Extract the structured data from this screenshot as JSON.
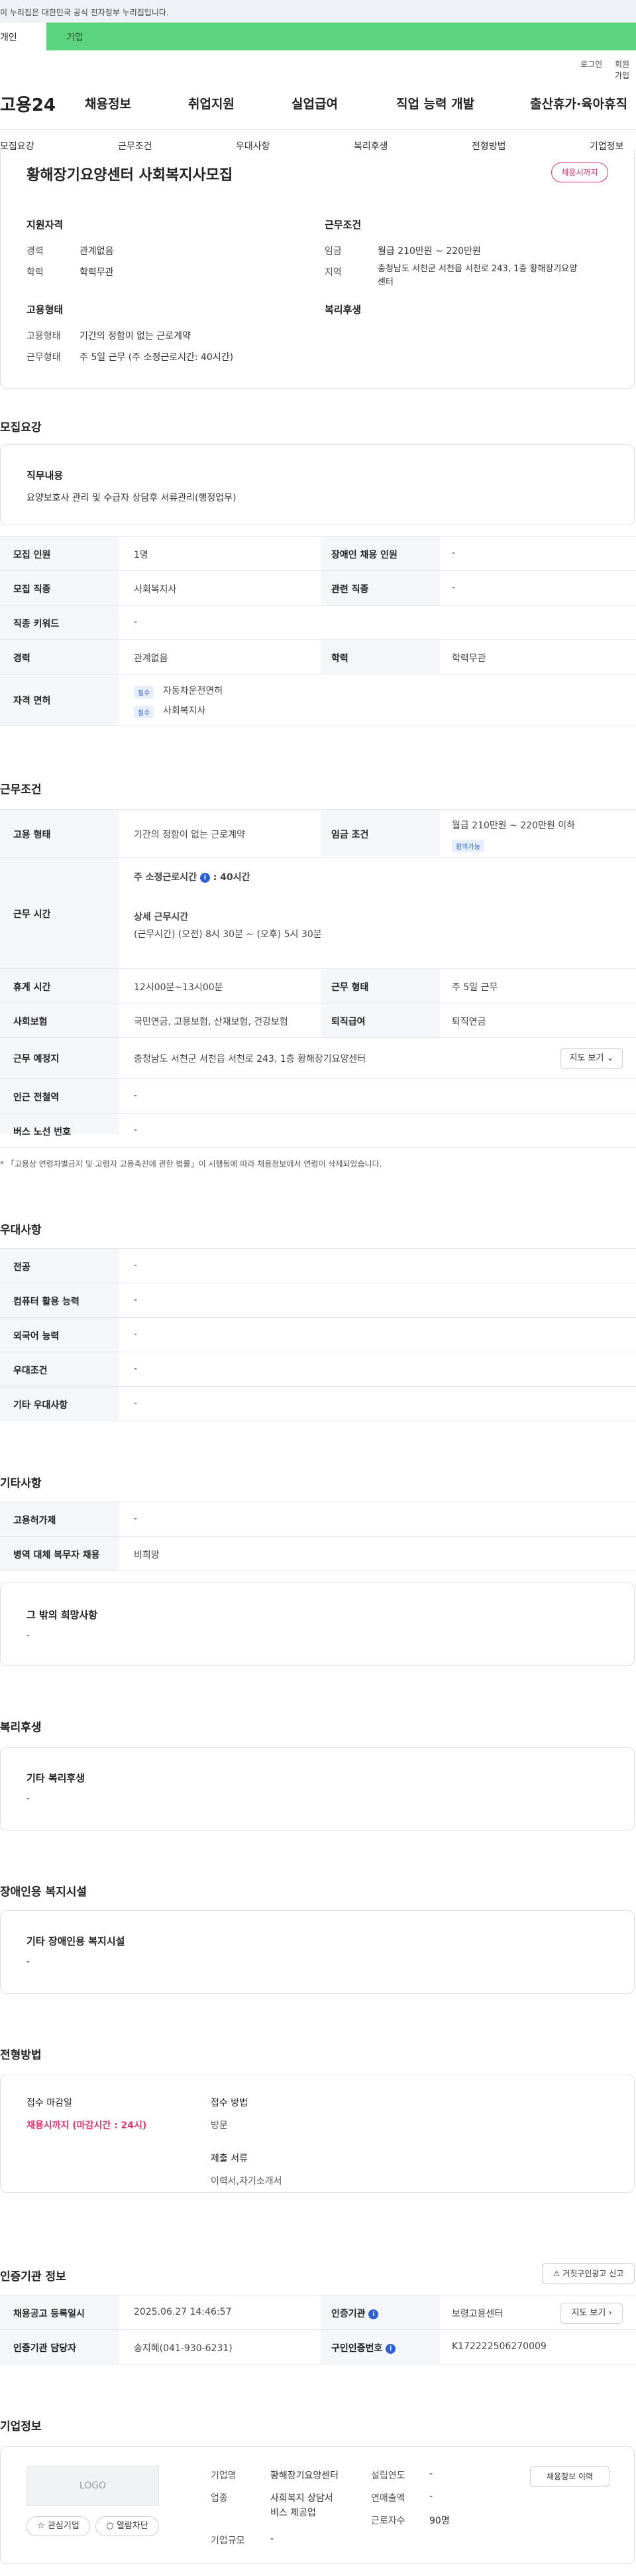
{
  "gov_bar": "이 누리집은 대한민국 공식 전자정부 누리집입니다.",
  "tabs": {
    "person": "개인",
    "company": "기업"
  },
  "util": {
    "login": "로그인",
    "signup": "회원가입"
  },
  "logo": "고용24",
  "gnb": [
    "채용정보",
    "취업지원",
    "실업급여",
    "직업 능력 개발",
    "출산휴가·육아휴직"
  ],
  "snb": [
    "모집요강",
    "근무조건",
    "우대사항",
    "복리후생",
    "전형방법",
    "기업정보"
  ],
  "summary": {
    "title": "황해장기요양센터 사회복지사모집",
    "badge": "채용시까지",
    "qual_h": "지원자격",
    "cond_h": "근무조건",
    "type_h": "고용형태",
    "welfare_h": "복리후생",
    "career_l": "경력",
    "career_v": "관계없음",
    "edu_l": "학력",
    "edu_v": "학력무관",
    "wage_l": "임금",
    "wage_v": "월급 210만원 ~ 220만원",
    "region_l": "지역",
    "region_v1": "충청남도 서천군 서천읍 서천로 243, 1층 황해장기요양",
    "region_v2": "센터",
    "emp_l": "고용형태",
    "emp_v": "기간의 정함이 없는 근로계약",
    "work_l": "근무형태",
    "work_v": "주 5일 근무 (주 소정근로시간: 40시간)"
  },
  "recruit": {
    "heading": "모집요강",
    "duty_h": "직무내용",
    "duty_v": "요양보호사 관리 및 수급자 상담후 서류관리(행정업무)",
    "rows": {
      "count_l": "모집 인원",
      "count_v": "1명",
      "disabled_l": "장애인 채용 인원",
      "disabled_v": "-",
      "job_l": "모집 직종",
      "job_v": "사회복지사",
      "rel_l": "관련 직종",
      "rel_v": "-",
      "kw_l": "직종 키워드",
      "kw_v": "-",
      "exp_l": "경력",
      "exp_v": "관계없음",
      "edu_l": "학력",
      "edu_v": "학력무관",
      "lic_l": "자격 면허",
      "lic_tag": "필수",
      "lic1": "자동차운전면허",
      "lic2": "사회복지사"
    }
  },
  "conditions": {
    "heading": "근무조건",
    "emp_l": "고용 형태",
    "emp_v": "기간의 정함이 없는 근로계약",
    "wage_l": "임금 조건",
    "wage_v": "월급 210만원 ~ 220만원 이하",
    "wage_tag": "협의가능",
    "hours_l": "근무 시간",
    "hours_a": "주 소정근로시간",
    "hours_info": "i",
    "hours_b": ": 40시간",
    "detail_h": "상세 근무시간",
    "detail_v": "(근무시간) (오전) 8시 30분 ~ (오후) 5시 30분",
    "rest_l": "휴게 시간",
    "rest_v": "12시00분~13시00분",
    "form_l": "근무 형태",
    "form_v": "주 5일 근무",
    "ins_l": "사회보험",
    "ins_v": "국민연금, 고용보험, 산재보험, 건강보험",
    "ret_l": "퇴직급여",
    "ret_v": "퇴직연금",
    "place_l": "근무 예정지",
    "place_v": "충청남도 서천군 서천읍 서천로 243, 1층 황해장기요양센터",
    "map_btn": "지도 보기",
    "sub_l": "인근 전철역",
    "sub_v": "-",
    "bus_l": "버스 노선 번호",
    "bus_v": "-",
    "note": "* 「고용상 연령차별금지 및 고령자 고용촉진에 관한 법률」이 시행됨에 따라 채용정보에서 연령이 삭제되었습니다."
  },
  "pref": {
    "heading": "우대사항",
    "major_l": "전공",
    "major_v": "-",
    "pc_l": "컴퓨터 활용 능력",
    "pc_v": "-",
    "lang_l": "외국어 능력",
    "lang_v": "-",
    "cond_l": "우대조건",
    "cond_v": "-",
    "etc_l": "기타 우대사항",
    "etc_v": "-"
  },
  "others": {
    "heading": "기타사항",
    "emp_l": "고용허가제",
    "emp_v": "-",
    "mil_l": "병역 대체 복무자 채용",
    "mil_v": "비희망",
    "wish_h": "그 밖의 희망사항",
    "wish_v": "-"
  },
  "welfare": {
    "heading": "복리후생",
    "box_h": "기타 복리후생",
    "box_v": "-"
  },
  "disab": {
    "heading": "장애인용 복지시설",
    "box_h": "기타 장애인용 복지시설",
    "box_v": "-"
  },
  "selection": {
    "heading": "전형방법",
    "deadline_h": "접수 마감일",
    "deadline_v": "채용시까지 (마감시간 : 24시)",
    "method_h": "접수 방법",
    "method_v": "방문",
    "docs_h": "제출 서류",
    "docs_v": "이력서,자기소개서"
  },
  "agency": {
    "heading": "인증기관 정보",
    "report_btn": "거짓구인광고 신고",
    "reg_l": "채용공고 등록일시",
    "reg_v": "2025.06.27 14:46:57",
    "org_l": "인증기관",
    "org_info": "i",
    "org_v": "보령고용센터",
    "map_btn": "지도 보기",
    "mgr_l": "인증기관 담당자",
    "mgr_v": "송지혜(041-930-6231)",
    "no_l": "구인인증번호",
    "no_info": "i",
    "no_v": "K172222506270009"
  },
  "company": {
    "heading": "기업정보",
    "logo": "LOGO",
    "fav_btn": "관심기업",
    "block_btn": "열람차단",
    "name_l": "기업명",
    "name_v": "황해장기요양센터",
    "ind_l": "업종",
    "ind_v1": "사회복지 상담서",
    "ind_v2": "비스 제공업",
    "size_l": "기업규모",
    "size_v": "-",
    "year_l": "설립연도",
    "year_v": "-",
    "sales_l": "연매출액",
    "sales_v": "-",
    "emp_l": "근로자수",
    "emp_v": "90명",
    "history_btn": "채용정보 이력"
  }
}
